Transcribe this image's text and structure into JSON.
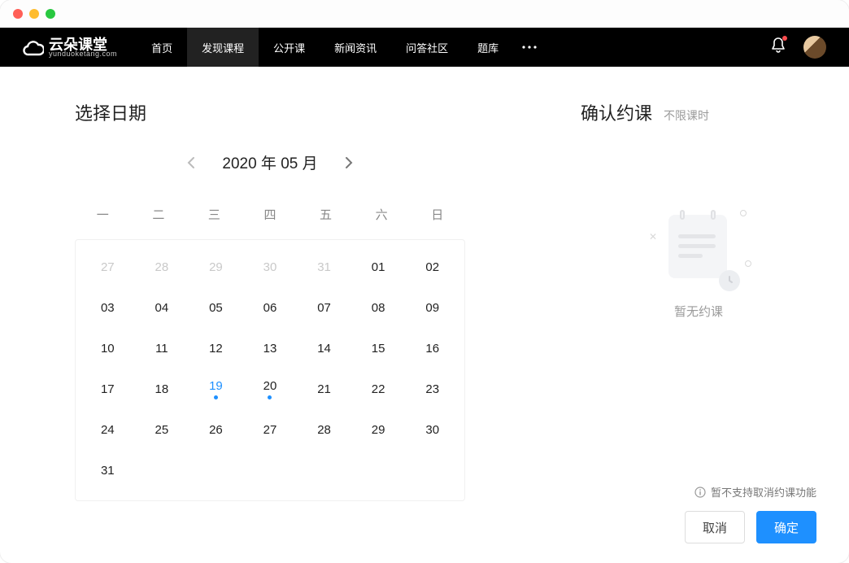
{
  "logo": {
    "text": "云朵课堂",
    "sub": "yunduoketang.com"
  },
  "nav": {
    "items": [
      "首页",
      "发现课程",
      "公开课",
      "新闻资讯",
      "问答社区",
      "题库"
    ],
    "active_index": 1
  },
  "left": {
    "title": "选择日期",
    "month_label": "2020 年 05 月",
    "weekdays": [
      "一",
      "二",
      "三",
      "四",
      "五",
      "六",
      "日"
    ],
    "cells": [
      {
        "d": "27",
        "t": "other"
      },
      {
        "d": "28",
        "t": "other"
      },
      {
        "d": "29",
        "t": "other"
      },
      {
        "d": "30",
        "t": "other"
      },
      {
        "d": "31",
        "t": "other"
      },
      {
        "d": "01",
        "t": "normal"
      },
      {
        "d": "02",
        "t": "normal"
      },
      {
        "d": "03",
        "t": "normal"
      },
      {
        "d": "04",
        "t": "normal"
      },
      {
        "d": "05",
        "t": "normal"
      },
      {
        "d": "06",
        "t": "normal"
      },
      {
        "d": "07",
        "t": "normal"
      },
      {
        "d": "08",
        "t": "normal"
      },
      {
        "d": "09",
        "t": "normal"
      },
      {
        "d": "10",
        "t": "normal"
      },
      {
        "d": "11",
        "t": "normal"
      },
      {
        "d": "12",
        "t": "normal"
      },
      {
        "d": "13",
        "t": "normal"
      },
      {
        "d": "14",
        "t": "normal"
      },
      {
        "d": "15",
        "t": "normal"
      },
      {
        "d": "16",
        "t": "normal"
      },
      {
        "d": "17",
        "t": "normal"
      },
      {
        "d": "18",
        "t": "normal"
      },
      {
        "d": "19",
        "t": "today",
        "dot": true
      },
      {
        "d": "20",
        "t": "normal",
        "dot": true
      },
      {
        "d": "21",
        "t": "normal"
      },
      {
        "d": "22",
        "t": "normal"
      },
      {
        "d": "23",
        "t": "normal"
      },
      {
        "d": "24",
        "t": "normal"
      },
      {
        "d": "25",
        "t": "normal"
      },
      {
        "d": "26",
        "t": "normal"
      },
      {
        "d": "27",
        "t": "normal"
      },
      {
        "d": "28",
        "t": "normal"
      },
      {
        "d": "29",
        "t": "normal"
      },
      {
        "d": "30",
        "t": "normal"
      },
      {
        "d": "31",
        "t": "normal"
      }
    ]
  },
  "right": {
    "title": "确认约课",
    "subtitle": "不限课时",
    "empty_text": "暂无约课",
    "note_text": "暂不支持取消约课功能",
    "cancel_label": "取消",
    "confirm_label": "确定"
  }
}
